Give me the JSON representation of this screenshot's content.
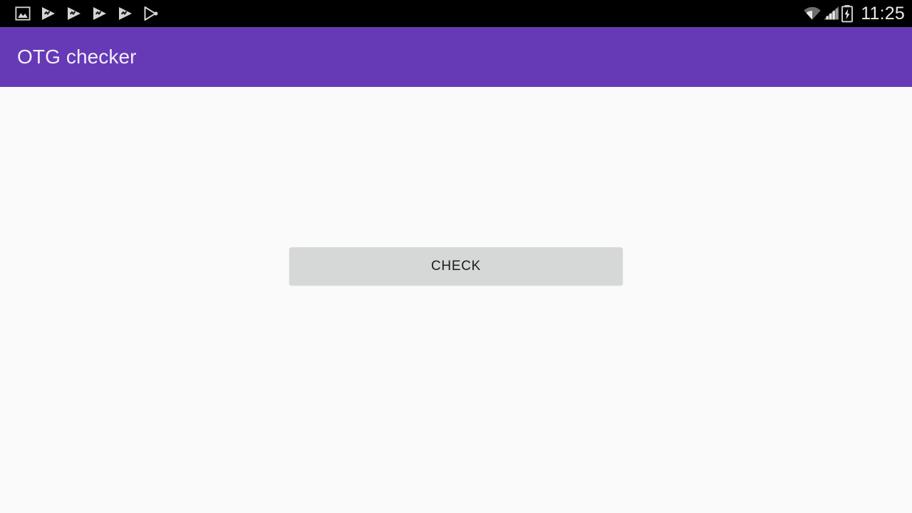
{
  "status_bar": {
    "background_color": "#000000",
    "clock": "11:25",
    "notification_icons": [
      {
        "name": "image-icon",
        "label": "Screenshot captured"
      },
      {
        "name": "play-store-update-icon-1",
        "label": "Play Store update"
      },
      {
        "name": "play-store-update-icon-2",
        "label": "Play Store update"
      },
      {
        "name": "play-store-update-icon-3",
        "label": "Play Store update"
      },
      {
        "name": "play-store-update-icon-4",
        "label": "Play Store update"
      },
      {
        "name": "play-store-outline-icon",
        "label": "Play Store"
      }
    ],
    "system_icons": [
      {
        "name": "wifi-icon",
        "label": "Wi-Fi connected"
      },
      {
        "name": "cellular-signal-icon",
        "label": "Cellular signal"
      },
      {
        "name": "battery-charging-icon",
        "label": "Battery charging"
      }
    ]
  },
  "app_bar": {
    "title": "OTG checker",
    "background_color": "#6639b6",
    "title_color": "#f2eefa"
  },
  "content": {
    "background_color": "#fafafa",
    "check_button": {
      "label": "CHECK",
      "background_color": "#d6d7d7",
      "text_color": "#1c1c1c"
    }
  }
}
